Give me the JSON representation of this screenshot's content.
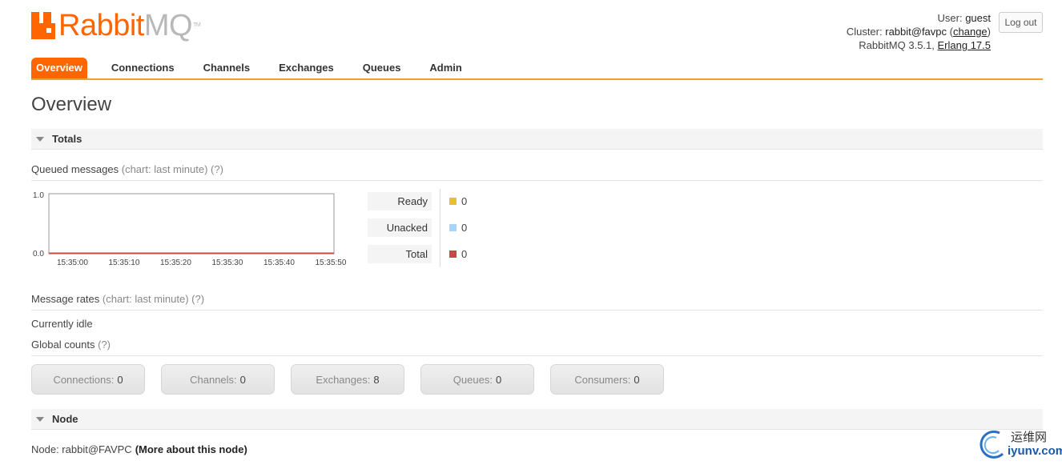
{
  "brand": {
    "rabbit": "Rabbit",
    "mq": "MQ",
    "tm": "TM"
  },
  "user": {
    "user_label": "User:",
    "user_name": "guest",
    "cluster_label": "Cluster:",
    "cluster_name": "rabbit@favpc",
    "change_open": "(",
    "change_link": "change",
    "change_close": ")",
    "version": "RabbitMQ 3.5.1,",
    "erlang": "Erlang 17.5",
    "logout": "Log out"
  },
  "tabs": [
    "Overview",
    "Connections",
    "Channels",
    "Exchanges",
    "Queues",
    "Admin"
  ],
  "page_title": "Overview",
  "totals": {
    "header": "Totals",
    "queued": {
      "label": "Queued messages",
      "hint": "(chart: last minute) (?)"
    },
    "legend": [
      {
        "label": "Ready",
        "value": "0",
        "color": "#e8bd37"
      },
      {
        "label": "Unacked",
        "value": "0",
        "color": "#a9d4f5"
      },
      {
        "label": "Total",
        "value": "0",
        "color": "#c64b47"
      }
    ],
    "rates": {
      "label": "Message rates",
      "hint": "(chart: last minute) (?)"
    },
    "idle": "Currently idle",
    "global": {
      "label": "Global counts",
      "hint": "(?)"
    },
    "counts": [
      {
        "label": "Connections:",
        "value": "0"
      },
      {
        "label": "Channels:",
        "value": "0"
      },
      {
        "label": "Exchanges:",
        "value": "8"
      },
      {
        "label": "Queues:",
        "value": "0"
      },
      {
        "label": "Consumers:",
        "value": "0"
      }
    ]
  },
  "node": {
    "header": "Node",
    "label": "Node: rabbit@FAVPC",
    "more": "(More about this node)"
  },
  "chart_data": {
    "type": "line",
    "x": [
      "15:35:00",
      "15:35:10",
      "15:35:20",
      "15:35:30",
      "15:35:40",
      "15:35:50"
    ],
    "series": [
      {
        "name": "Ready",
        "values": [
          0,
          0,
          0,
          0,
          0,
          0
        ],
        "color": "#e8bd37"
      },
      {
        "name": "Unacked",
        "values": [
          0,
          0,
          0,
          0,
          0,
          0
        ],
        "color": "#a9d4f5"
      },
      {
        "name": "Total",
        "values": [
          0,
          0,
          0,
          0,
          0,
          0
        ],
        "color": "#c64b47"
      }
    ],
    "yticks": [
      "1.0",
      "0.0"
    ],
    "ylim": [
      0,
      1
    ]
  },
  "watermark": {
    "cn": "运维网",
    "site": "iyunv.com"
  }
}
